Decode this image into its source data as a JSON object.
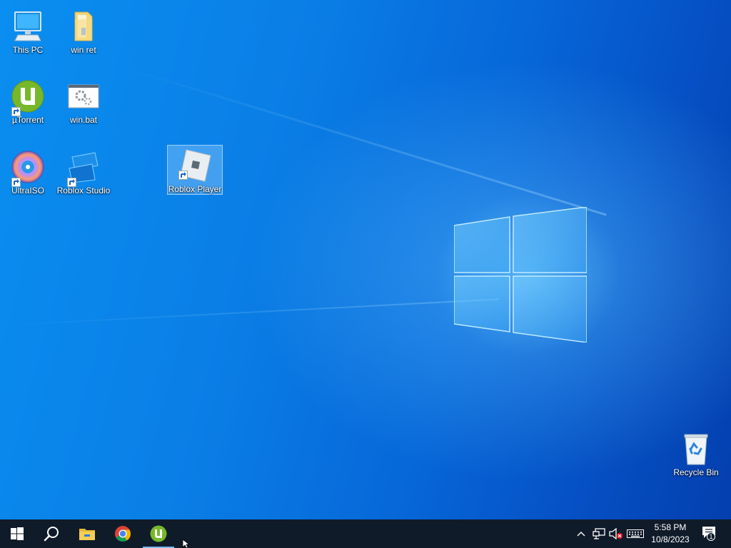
{
  "desktop": {
    "icons": [
      {
        "label": "This PC",
        "icon": "this-pc-icon"
      },
      {
        "label": "win ret",
        "icon": "folder-icon"
      },
      {
        "label": "µTorrent",
        "icon": "utorrent-icon"
      },
      {
        "label": "win.bat",
        "icon": "batch-file-icon"
      },
      {
        "label": "UltraISO",
        "icon": "ultraiso-icon"
      },
      {
        "label": "Roblox Studio",
        "icon": "roblox-studio-icon"
      },
      {
        "label": "Roblox Player",
        "icon": "roblox-player-icon",
        "selected": true
      },
      {
        "label": "Recycle Bin",
        "icon": "recycle-bin-icon"
      }
    ]
  },
  "taskbar": {
    "pinned": [
      {
        "icon": "windows-start-icon"
      },
      {
        "icon": "search-icon"
      },
      {
        "icon": "file-explorer-icon"
      },
      {
        "icon": "chrome-icon"
      },
      {
        "icon": "utorrent-icon",
        "active": true
      }
    ],
    "tray": {
      "icons": [
        "chevron-up-icon",
        "network-icon",
        "volume-muted-icon",
        "keyboard-icon"
      ],
      "time": "5:58 PM",
      "date": "10/8/2023",
      "notification_count": "1"
    }
  },
  "colors": {
    "desktop_accent": "#0a7fe6",
    "taskbar": "#101b2a",
    "active_indicator": "#76b9ed",
    "utorrent_green": "#76b82a"
  }
}
